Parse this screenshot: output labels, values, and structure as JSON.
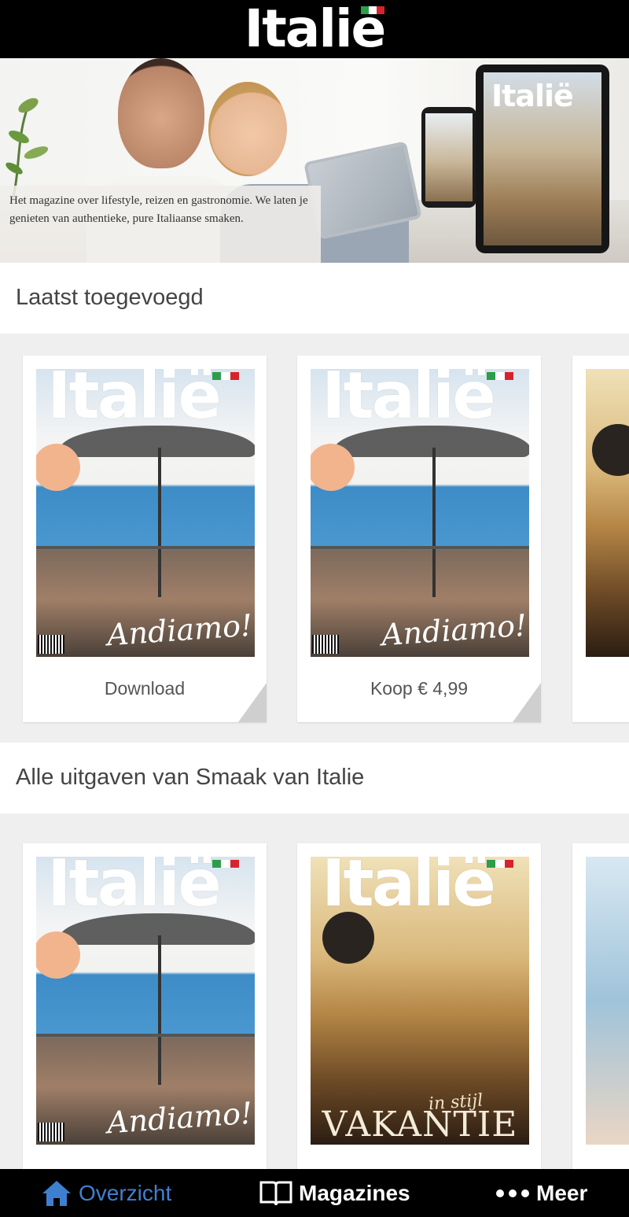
{
  "header": {
    "logo_text": "Italië",
    "flag_colors": [
      "#2e9d4a",
      "#ffffff",
      "#d7242c"
    ]
  },
  "hero": {
    "caption": "Het magazine over lifestyle, reizen en gastronomie. We laten je genieten van authentieke, pure Italiaanse smaken.",
    "device_logo": "Italië"
  },
  "sections": {
    "latest_title": "Laatst toegevoegd",
    "all_title": "Alle uitgaven van Smaak van Italie"
  },
  "latest": [
    {
      "logo": "Italië",
      "script": "Andiamo!",
      "action": "Download"
    },
    {
      "logo": "Italië",
      "script": "Andiamo!",
      "action": "Koop € 4,99"
    }
  ],
  "all": [
    {
      "logo": "Italië",
      "script": "Andiamo!"
    },
    {
      "logo": "Italië",
      "title": "VAKANTIE",
      "script": "in stijl"
    }
  ],
  "bottom_nav": [
    {
      "label": "Overzicht",
      "icon": "home-icon",
      "active": true
    },
    {
      "label": "Magazines",
      "icon": "book-icon",
      "active": false
    },
    {
      "label": "Meer",
      "icon": "more-dots-icon",
      "active": false
    }
  ],
  "colors": {
    "active_nav": "#3f7fd0",
    "bar_background": "#000000",
    "strip_background": "#efefef"
  }
}
